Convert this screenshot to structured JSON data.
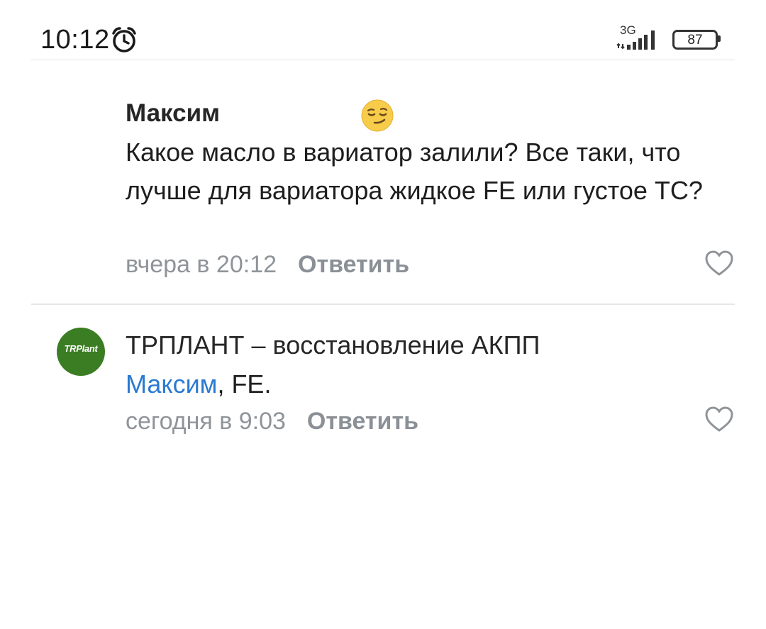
{
  "status_bar": {
    "time": "10:12",
    "network": "3G",
    "battery": "87"
  },
  "comments": [
    {
      "author": "Максим",
      "text": "Какое масло в вариатор залили? Все таки, что лучше для вариатора жидкое FE или густое TC?",
      "timestamp": "вчера в 20:12",
      "reply_label": "Ответить"
    },
    {
      "author": "ТРПЛАНТ – восстановление АКПП",
      "avatar_text": "TRPlant",
      "mention": "Максим",
      "text": ", FE.",
      "timestamp": "сегодня в 9:03",
      "reply_label": "Ответить"
    }
  ],
  "colors": {
    "mention": "#2a7ad1",
    "meta": "#8f9499",
    "avatar_bg": "#3a7d22"
  }
}
